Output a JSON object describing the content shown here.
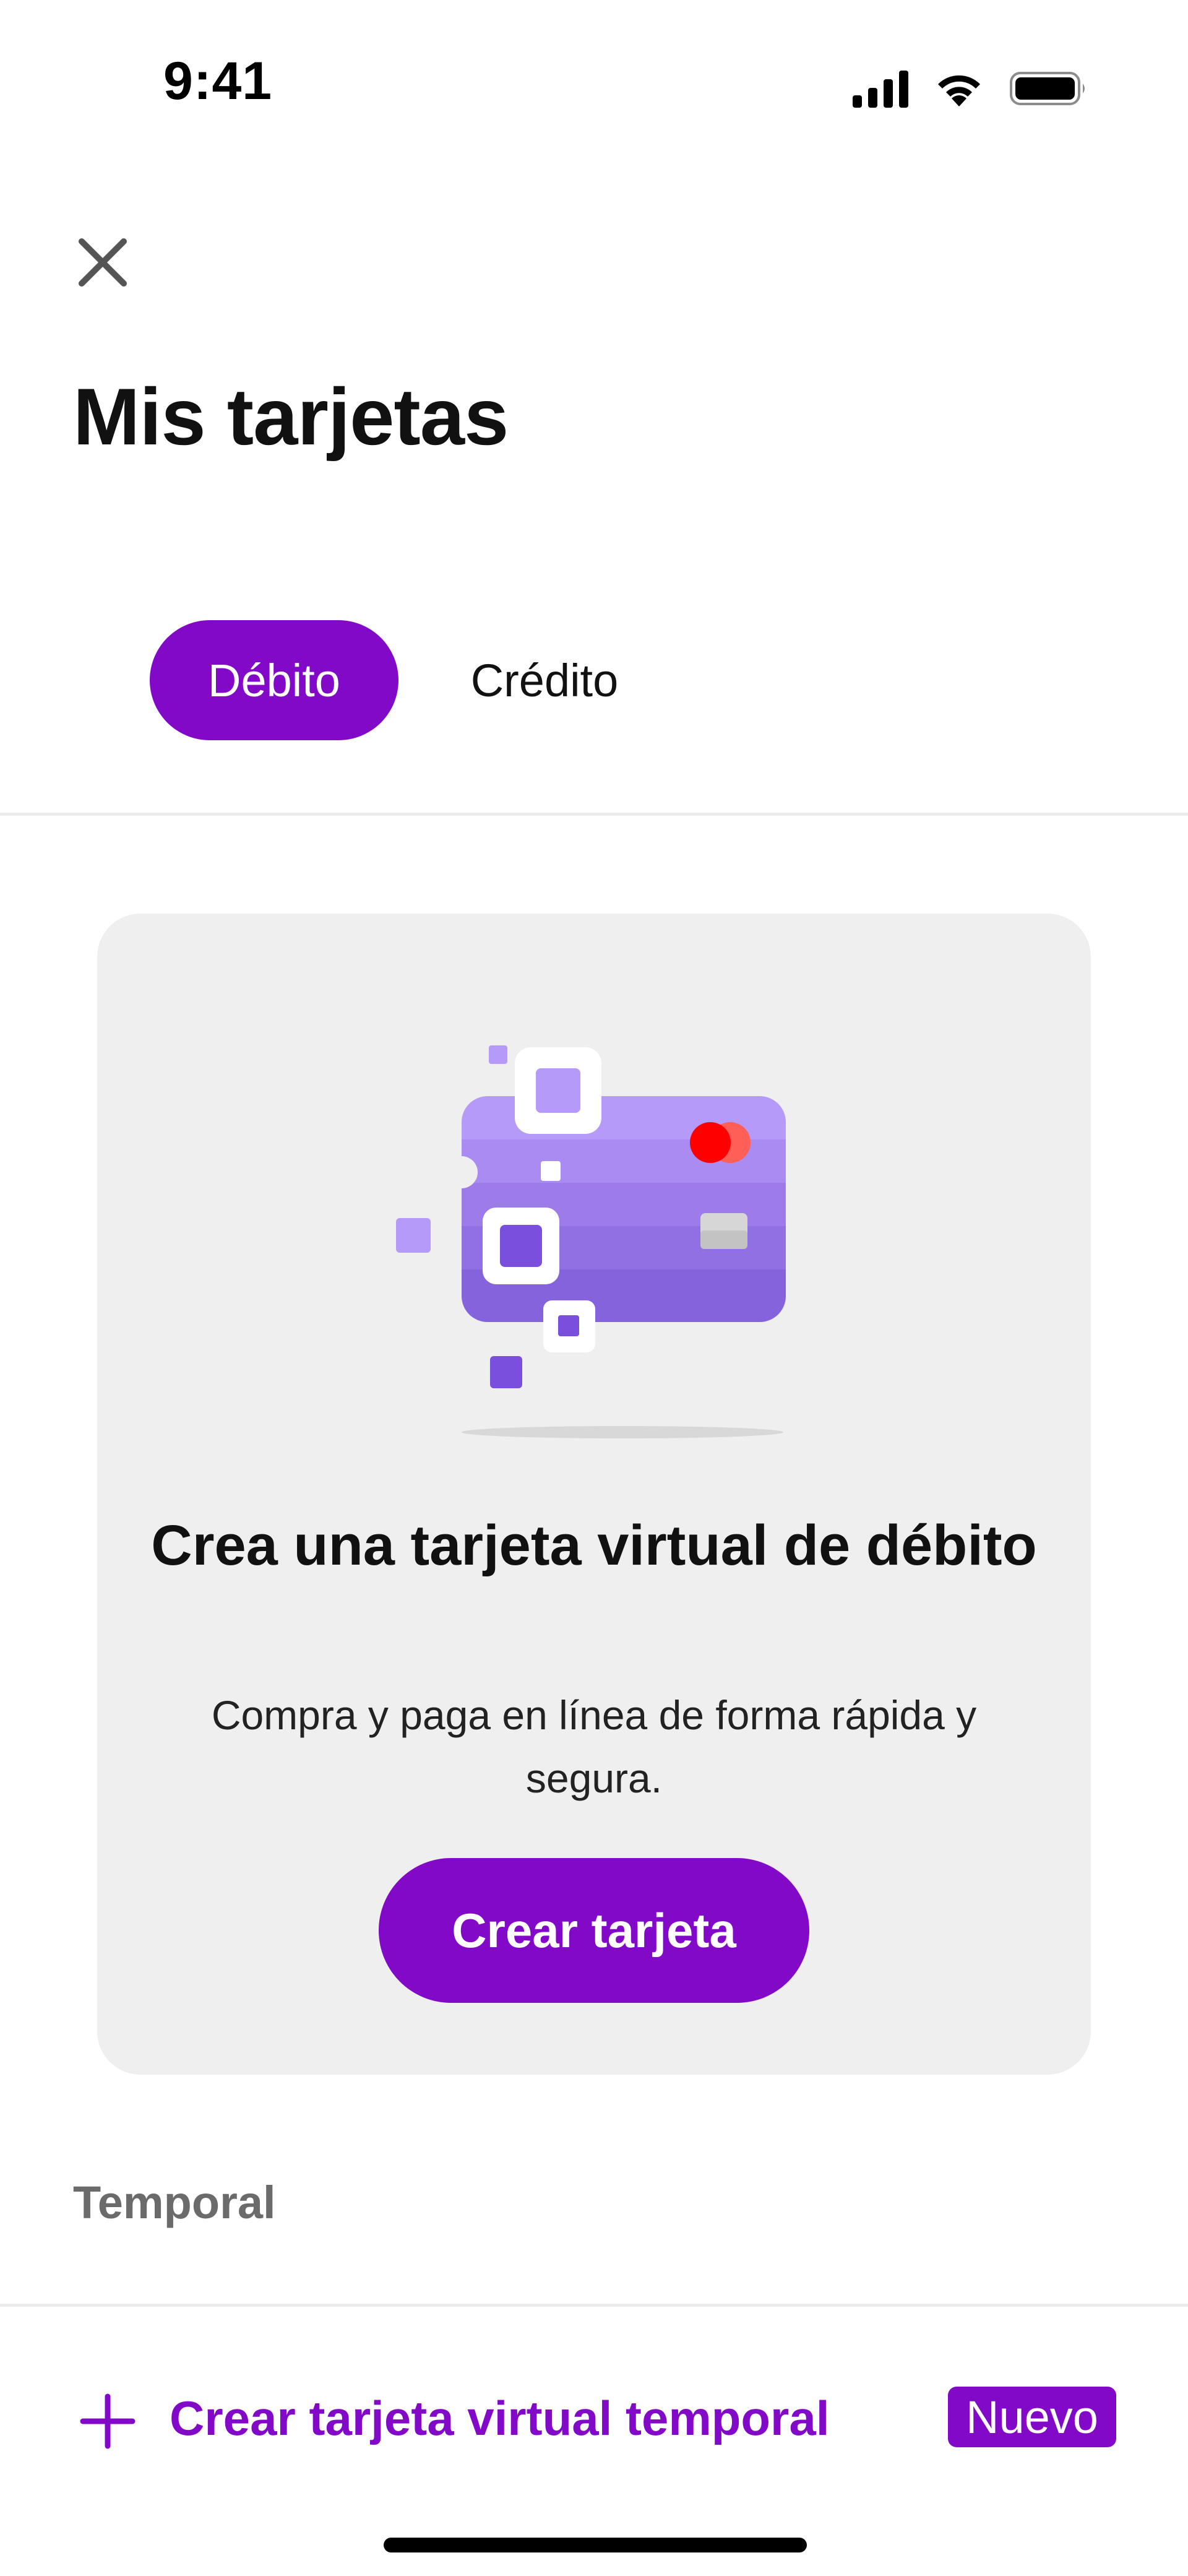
{
  "status_bar": {
    "time": "9:41"
  },
  "header": {
    "title": "Mis tarjetas",
    "close_icon": "close-icon"
  },
  "tabs": [
    {
      "label": "Débito",
      "selected": true
    },
    {
      "label": "Crédito",
      "selected": false
    }
  ],
  "promo_card": {
    "title": "Crea una tarjeta virtual de débito",
    "description": "Compra y paga en línea de forma rápida y segura.",
    "button_label": "Crear tarjeta",
    "illustration": "virtual-card-illustration"
  },
  "section": {
    "label": "Temporal",
    "row_label": "Crear tarjeta virtual temporal",
    "row_icon": "plus-icon",
    "badge": "Nuevo"
  },
  "colors": {
    "accent": "#8309c9",
    "card_background": "#efefef",
    "section_label": "#6b6b6b"
  }
}
